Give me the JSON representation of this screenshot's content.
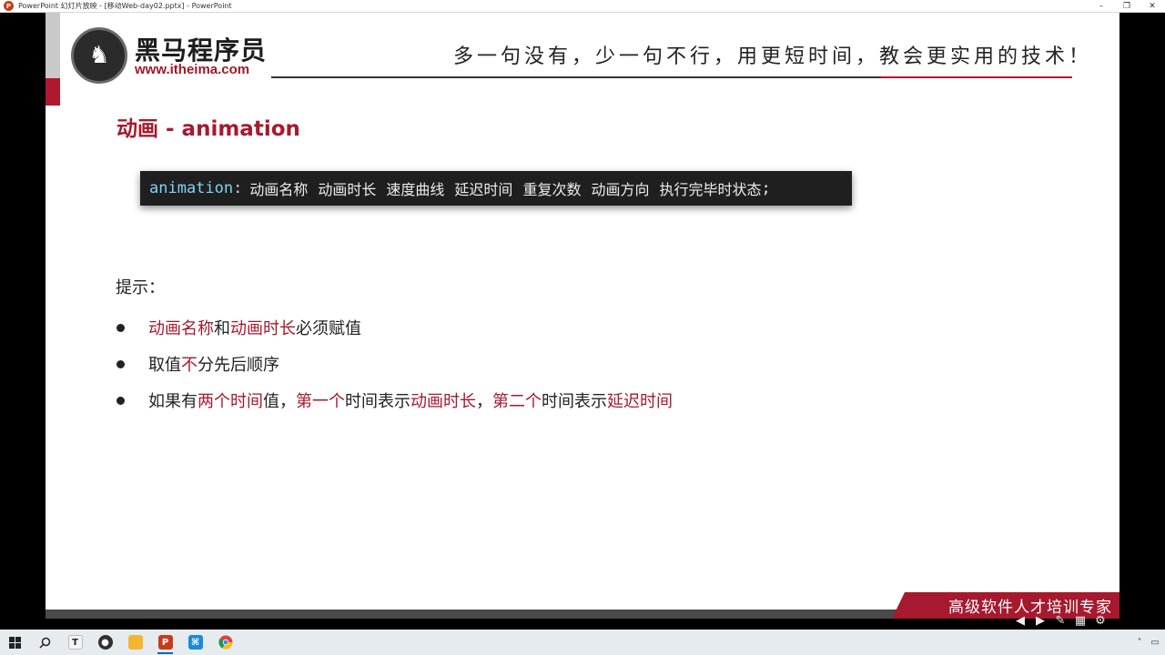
{
  "window": {
    "title": "PowerPoint 幻灯片放映 - [移动Web-day02.pptx] - PowerPoint",
    "controls": [
      "minimize",
      "restore",
      "close"
    ]
  },
  "slide": {
    "logo_name": "黑马程序员",
    "logo_url": "www.itheima.com",
    "slogan": "多一句没有，少一句不行，用更短时间，教会更实用的技术！",
    "heading": "动画 - animation",
    "code": {
      "property": "animation",
      "colon": ":",
      "params": [
        "动画名称",
        "动画时长",
        "速度曲线",
        "延迟时间",
        "重复次数",
        "动画方向",
        "执行完毕时状态"
      ],
      "terminator": ";"
    },
    "tip_label": "提示：",
    "bullets": [
      {
        "segments": [
          {
            "text": "动画名称",
            "red": true
          },
          {
            "text": "和",
            "red": false
          },
          {
            "text": "动画时长",
            "red": true
          },
          {
            "text": "必须赋值",
            "red": false
          }
        ]
      },
      {
        "segments": [
          {
            "text": "取值",
            "red": false
          },
          {
            "text": "不",
            "red": true
          },
          {
            "text": "分先后顺序",
            "red": false
          }
        ]
      },
      {
        "segments": [
          {
            "text": "如果有",
            "red": false
          },
          {
            "text": "两个时间",
            "red": true
          },
          {
            "text": "值，",
            "red": false
          },
          {
            "text": "第一个",
            "red": true
          },
          {
            "text": "时间表示",
            "red": false
          },
          {
            "text": "动画时长",
            "red": true
          },
          {
            "text": "，",
            "red": false
          },
          {
            "text": "第二个",
            "red": true
          },
          {
            "text": "时间表示",
            "red": false
          },
          {
            "text": "延迟时间",
            "red": true
          }
        ]
      }
    ],
    "banner": "高级软件人才培训专家",
    "colors": {
      "accent": "#a6192e",
      "code_bg": "#1f1f1f",
      "code_keyword": "#7fd3f5"
    }
  },
  "taskbar": {
    "items": [
      {
        "name": "start",
        "icon": "windows-icon"
      },
      {
        "name": "search",
        "icon": "search-icon"
      },
      {
        "name": "typora",
        "icon": "T",
        "color": "#2c2c2c"
      },
      {
        "name": "obs",
        "icon": "record-icon",
        "color": "#303030"
      },
      {
        "name": "explorer",
        "icon": "folder-icon",
        "color": "#f2b632"
      },
      {
        "name": "powerpoint",
        "icon": "P",
        "color": "#c43e1c",
        "active": true
      },
      {
        "name": "vscode",
        "icon": "code-icon",
        "color": "#1f8ad2"
      },
      {
        "name": "chrome",
        "icon": "chrome-icon",
        "color": "#db4437"
      }
    ]
  }
}
